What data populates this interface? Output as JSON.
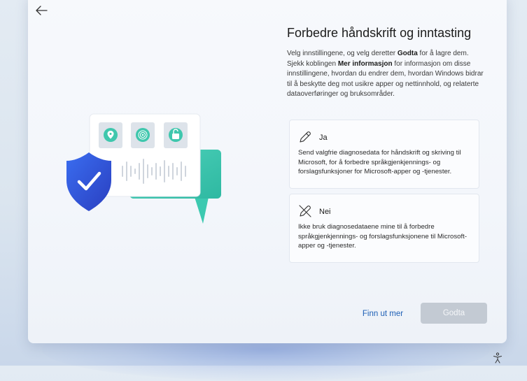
{
  "page": {
    "title": "Forbedre håndskrift og inntasting",
    "description_parts": {
      "p1": "Velg innstillingene, og velg deretter ",
      "bold1": "Godta",
      "p2": " for å lagre dem. Sjekk koblingen ",
      "bold2": "Mer informasjon",
      "p3": " for informasjon om disse innstillingene, hvordan du endrer dem, hvordan Windows bidrar til å beskytte deg mot usikre apper og nettinnhold, og relaterte dataoverføringer og bruksområder."
    }
  },
  "options": {
    "yes": {
      "label": "Ja",
      "text": "Send valgfrie diagnosedata for håndskrift og skriving til Microsoft, for å forbedre språkgjenkjennings- og forslagsfunksjoner for Microsoft-apper og -tjenester.",
      "icon": "pen-icon"
    },
    "no": {
      "label": "Nei",
      "text": "Ikke bruk diagnosedataene mine til å forbedre språkgjenkjennings- og forslagsfunksjonene til Microsoft-apper og -tjenester.",
      "icon": "pen-off-icon"
    }
  },
  "footer": {
    "link_label": "Finn ut mer",
    "accept_label": "Godta"
  },
  "icons": {
    "back": "back-arrow-icon",
    "accessibility": "accessibility-icon"
  },
  "colors": {
    "accent_link": "#1d5fb5",
    "button_disabled": "#c3cad3",
    "shield": "#2a57d6",
    "teal": "#2fc3a8"
  }
}
